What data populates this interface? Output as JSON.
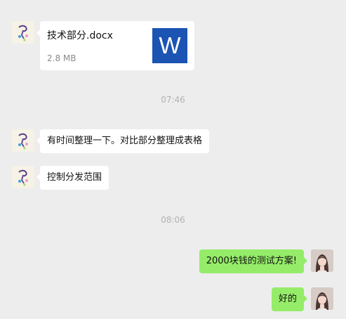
{
  "messages": {
    "file": {
      "name": "技术部分.docx",
      "size": "2.8 MB",
      "icon_letter": "W",
      "icon": "word-document-icon"
    },
    "time1": "07:46",
    "msg1": "有时间整理一下。对比部分整理成表格",
    "msg2": "控制分发范围",
    "time2": "08:06",
    "msg3": "2000块钱的测试方案!",
    "msg4": "好的"
  },
  "colors": {
    "background": "#ededed",
    "incoming_bubble": "#ffffff",
    "outgoing_bubble": "#95ec69",
    "word_icon": "#1b54b3",
    "timestamp": "#b2b2b2"
  }
}
